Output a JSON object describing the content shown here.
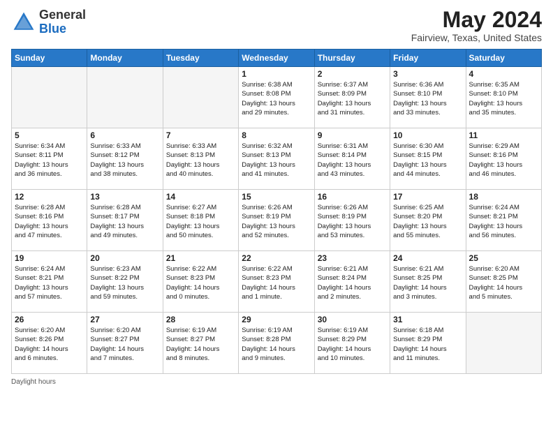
{
  "header": {
    "logo_general": "General",
    "logo_blue": "Blue",
    "month_year": "May 2024",
    "location": "Fairview, Texas, United States"
  },
  "days_of_week": [
    "Sunday",
    "Monday",
    "Tuesday",
    "Wednesday",
    "Thursday",
    "Friday",
    "Saturday"
  ],
  "weeks": [
    [
      {
        "day": "",
        "info": ""
      },
      {
        "day": "",
        "info": ""
      },
      {
        "day": "",
        "info": ""
      },
      {
        "day": "1",
        "info": "Sunrise: 6:38 AM\nSunset: 8:08 PM\nDaylight: 13 hours\nand 29 minutes."
      },
      {
        "day": "2",
        "info": "Sunrise: 6:37 AM\nSunset: 8:09 PM\nDaylight: 13 hours\nand 31 minutes."
      },
      {
        "day": "3",
        "info": "Sunrise: 6:36 AM\nSunset: 8:10 PM\nDaylight: 13 hours\nand 33 minutes."
      },
      {
        "day": "4",
        "info": "Sunrise: 6:35 AM\nSunset: 8:10 PM\nDaylight: 13 hours\nand 35 minutes."
      }
    ],
    [
      {
        "day": "5",
        "info": "Sunrise: 6:34 AM\nSunset: 8:11 PM\nDaylight: 13 hours\nand 36 minutes."
      },
      {
        "day": "6",
        "info": "Sunrise: 6:33 AM\nSunset: 8:12 PM\nDaylight: 13 hours\nand 38 minutes."
      },
      {
        "day": "7",
        "info": "Sunrise: 6:33 AM\nSunset: 8:13 PM\nDaylight: 13 hours\nand 40 minutes."
      },
      {
        "day": "8",
        "info": "Sunrise: 6:32 AM\nSunset: 8:13 PM\nDaylight: 13 hours\nand 41 minutes."
      },
      {
        "day": "9",
        "info": "Sunrise: 6:31 AM\nSunset: 8:14 PM\nDaylight: 13 hours\nand 43 minutes."
      },
      {
        "day": "10",
        "info": "Sunrise: 6:30 AM\nSunset: 8:15 PM\nDaylight: 13 hours\nand 44 minutes."
      },
      {
        "day": "11",
        "info": "Sunrise: 6:29 AM\nSunset: 8:16 PM\nDaylight: 13 hours\nand 46 minutes."
      }
    ],
    [
      {
        "day": "12",
        "info": "Sunrise: 6:28 AM\nSunset: 8:16 PM\nDaylight: 13 hours\nand 47 minutes."
      },
      {
        "day": "13",
        "info": "Sunrise: 6:28 AM\nSunset: 8:17 PM\nDaylight: 13 hours\nand 49 minutes."
      },
      {
        "day": "14",
        "info": "Sunrise: 6:27 AM\nSunset: 8:18 PM\nDaylight: 13 hours\nand 50 minutes."
      },
      {
        "day": "15",
        "info": "Sunrise: 6:26 AM\nSunset: 8:19 PM\nDaylight: 13 hours\nand 52 minutes."
      },
      {
        "day": "16",
        "info": "Sunrise: 6:26 AM\nSunset: 8:19 PM\nDaylight: 13 hours\nand 53 minutes."
      },
      {
        "day": "17",
        "info": "Sunrise: 6:25 AM\nSunset: 8:20 PM\nDaylight: 13 hours\nand 55 minutes."
      },
      {
        "day": "18",
        "info": "Sunrise: 6:24 AM\nSunset: 8:21 PM\nDaylight: 13 hours\nand 56 minutes."
      }
    ],
    [
      {
        "day": "19",
        "info": "Sunrise: 6:24 AM\nSunset: 8:21 PM\nDaylight: 13 hours\nand 57 minutes."
      },
      {
        "day": "20",
        "info": "Sunrise: 6:23 AM\nSunset: 8:22 PM\nDaylight: 13 hours\nand 59 minutes."
      },
      {
        "day": "21",
        "info": "Sunrise: 6:22 AM\nSunset: 8:23 PM\nDaylight: 14 hours\nand 0 minutes."
      },
      {
        "day": "22",
        "info": "Sunrise: 6:22 AM\nSunset: 8:23 PM\nDaylight: 14 hours\nand 1 minute."
      },
      {
        "day": "23",
        "info": "Sunrise: 6:21 AM\nSunset: 8:24 PM\nDaylight: 14 hours\nand 2 minutes."
      },
      {
        "day": "24",
        "info": "Sunrise: 6:21 AM\nSunset: 8:25 PM\nDaylight: 14 hours\nand 3 minutes."
      },
      {
        "day": "25",
        "info": "Sunrise: 6:20 AM\nSunset: 8:25 PM\nDaylight: 14 hours\nand 5 minutes."
      }
    ],
    [
      {
        "day": "26",
        "info": "Sunrise: 6:20 AM\nSunset: 8:26 PM\nDaylight: 14 hours\nand 6 minutes."
      },
      {
        "day": "27",
        "info": "Sunrise: 6:20 AM\nSunset: 8:27 PM\nDaylight: 14 hours\nand 7 minutes."
      },
      {
        "day": "28",
        "info": "Sunrise: 6:19 AM\nSunset: 8:27 PM\nDaylight: 14 hours\nand 8 minutes."
      },
      {
        "day": "29",
        "info": "Sunrise: 6:19 AM\nSunset: 8:28 PM\nDaylight: 14 hours\nand 9 minutes."
      },
      {
        "day": "30",
        "info": "Sunrise: 6:19 AM\nSunset: 8:29 PM\nDaylight: 14 hours\nand 10 minutes."
      },
      {
        "day": "31",
        "info": "Sunrise: 6:18 AM\nSunset: 8:29 PM\nDaylight: 14 hours\nand 11 minutes."
      },
      {
        "day": "",
        "info": ""
      }
    ]
  ],
  "footer": {
    "daylight_hours": "Daylight hours"
  }
}
